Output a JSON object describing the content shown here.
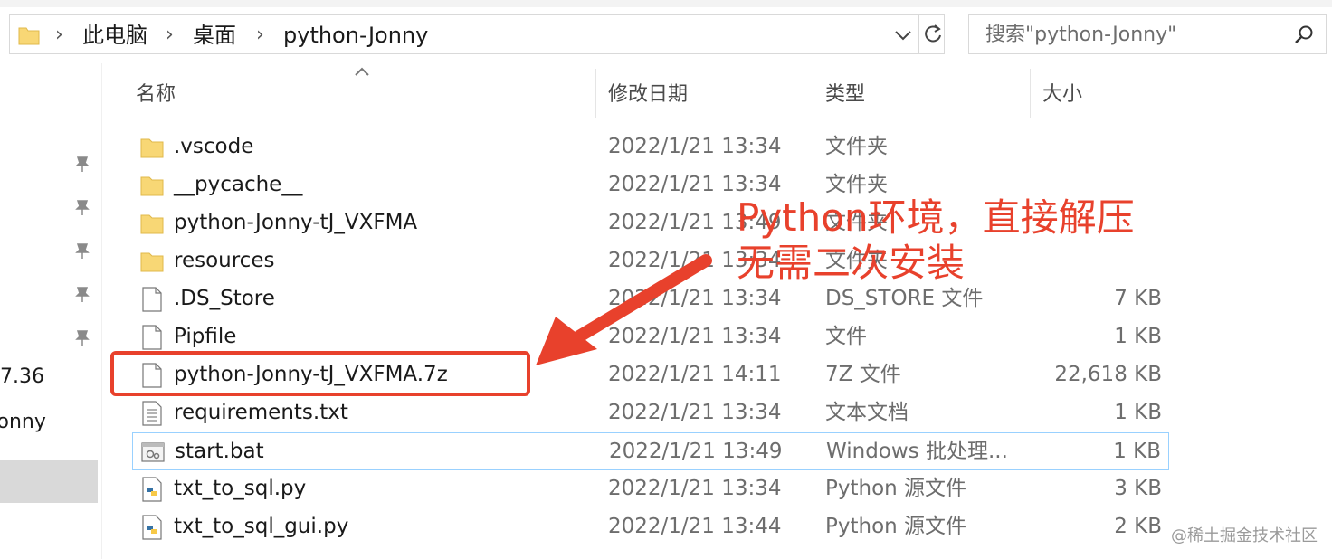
{
  "breadcrumb": [
    "此电脑",
    "桌面",
    "python-Jonny"
  ],
  "search": {
    "placeholder": "搜索\"python-Jonny\""
  },
  "nav": {
    "items": [
      "7.36",
      "Jonny"
    ]
  },
  "columns": {
    "name": "名称",
    "date": "修改日期",
    "type": "类型",
    "size": "大小"
  },
  "files": [
    {
      "icon": "folder-icon",
      "name": ".vscode",
      "date": "2022/1/21 13:34",
      "type": "文件夹",
      "size": ""
    },
    {
      "icon": "folder-icon",
      "name": "__pycache__",
      "date": "2022/1/21 13:34",
      "type": "文件夹",
      "size": ""
    },
    {
      "icon": "folder-icon",
      "name": "python-Jonny-tJ_VXFMA",
      "date": "2022/1/21 13:49",
      "type": "文件夹",
      "size": ""
    },
    {
      "icon": "folder-icon",
      "name": "resources",
      "date": "2022/1/21 13:34",
      "type": "文件夹",
      "size": ""
    },
    {
      "icon": "file-icon",
      "name": ".DS_Store",
      "date": "2022/1/21 13:34",
      "type": "DS_STORE 文件",
      "size": "7 KB"
    },
    {
      "icon": "file-icon",
      "name": "Pipfile",
      "date": "2022/1/21 13:34",
      "type": "文件",
      "size": "1 KB"
    },
    {
      "icon": "file-icon",
      "name": "python-Jonny-tJ_VXFMA.7z",
      "date": "2022/1/21 14:11",
      "type": "7Z 文件",
      "size": "22,618 KB"
    },
    {
      "icon": "text-file-icon",
      "name": "requirements.txt",
      "date": "2022/1/21 13:34",
      "type": "文本文档",
      "size": "1 KB"
    },
    {
      "icon": "batch-file-icon",
      "name": "start.bat",
      "date": "2022/1/21 13:49",
      "type": "Windows 批处理...",
      "size": "1 KB"
    },
    {
      "icon": "python-file-icon",
      "name": "txt_to_sql.py",
      "date": "2022/1/21 13:34",
      "type": "Python 源文件",
      "size": "3 KB"
    },
    {
      "icon": "python-file-icon",
      "name": "txt_to_sql_gui.py",
      "date": "2022/1/21 13:44",
      "type": "Python 源文件",
      "size": "2 KB"
    }
  ],
  "annotation": {
    "line1": "Python环境，直接解压",
    "line2": "无需二次安装",
    "color": "#e8412c"
  },
  "watermark": "@稀土掘金技术社区",
  "colors": {
    "selection_border": "#99d1ff",
    "folder": "#f8d775"
  }
}
